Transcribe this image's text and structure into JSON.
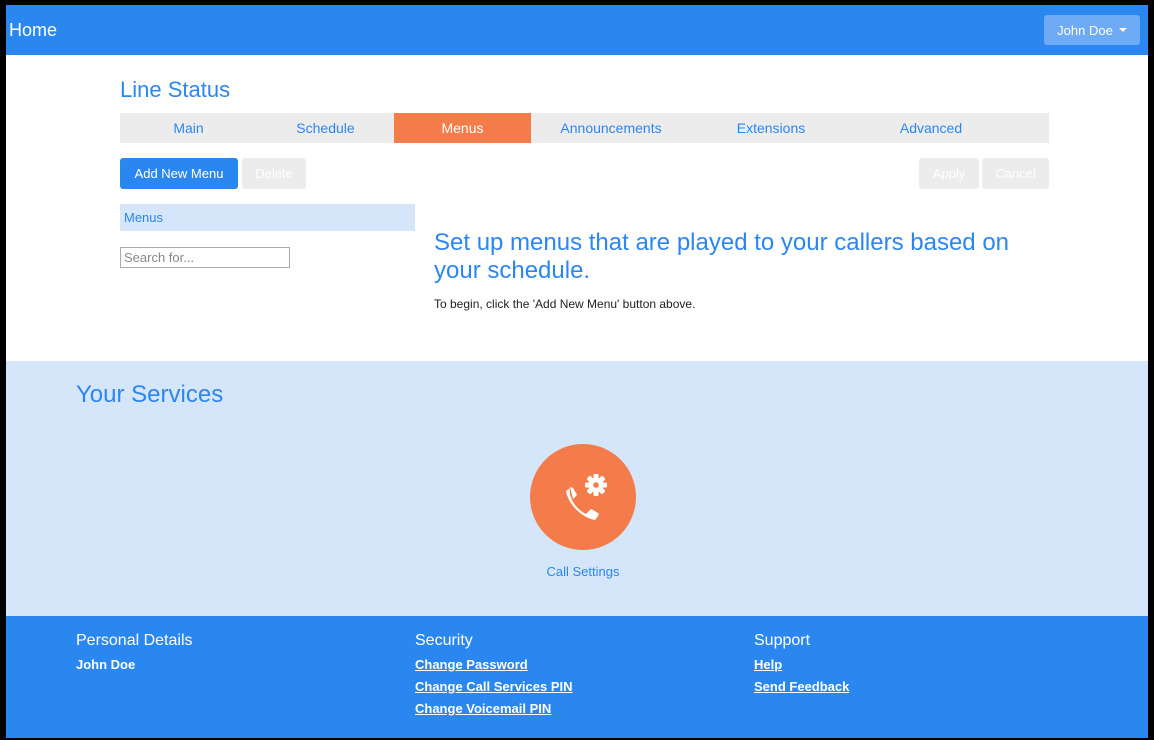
{
  "topnav": {
    "brand": "Home",
    "user_label": "John Doe"
  },
  "page": {
    "title": "Line Status",
    "tabs": [
      {
        "label": "Main"
      },
      {
        "label": "Schedule"
      },
      {
        "label": "Menus",
        "active": true
      },
      {
        "label": "Announcements"
      },
      {
        "label": "Extensions"
      },
      {
        "label": "Advanced"
      }
    ],
    "buttons": {
      "add_new_menu": "Add New Menu",
      "delete": "Delete",
      "apply": "Apply",
      "cancel": "Cancel"
    },
    "menus_header": "Menus",
    "search_placeholder": "Search for...",
    "headline": "Set up menus that are played to your callers based on your schedule.",
    "instruction": "To begin, click the 'Add New Menu' button above."
  },
  "services": {
    "title": "Your Services",
    "items": [
      {
        "label": "Call Settings",
        "icon": "phone-gear-icon"
      }
    ]
  },
  "footer": {
    "personal": {
      "heading": "Personal Details",
      "name": "John Doe"
    },
    "security": {
      "heading": "Security",
      "links": [
        "Change Password",
        "Change Call Services PIN",
        "Change Voicemail PIN"
      ]
    },
    "support": {
      "heading": "Support",
      "links": [
        "Help",
        "Send Feedback"
      ]
    }
  },
  "colors": {
    "primary": "#2b87f0",
    "accent": "#f47c4a",
    "light_panel": "#d5e5fa"
  }
}
